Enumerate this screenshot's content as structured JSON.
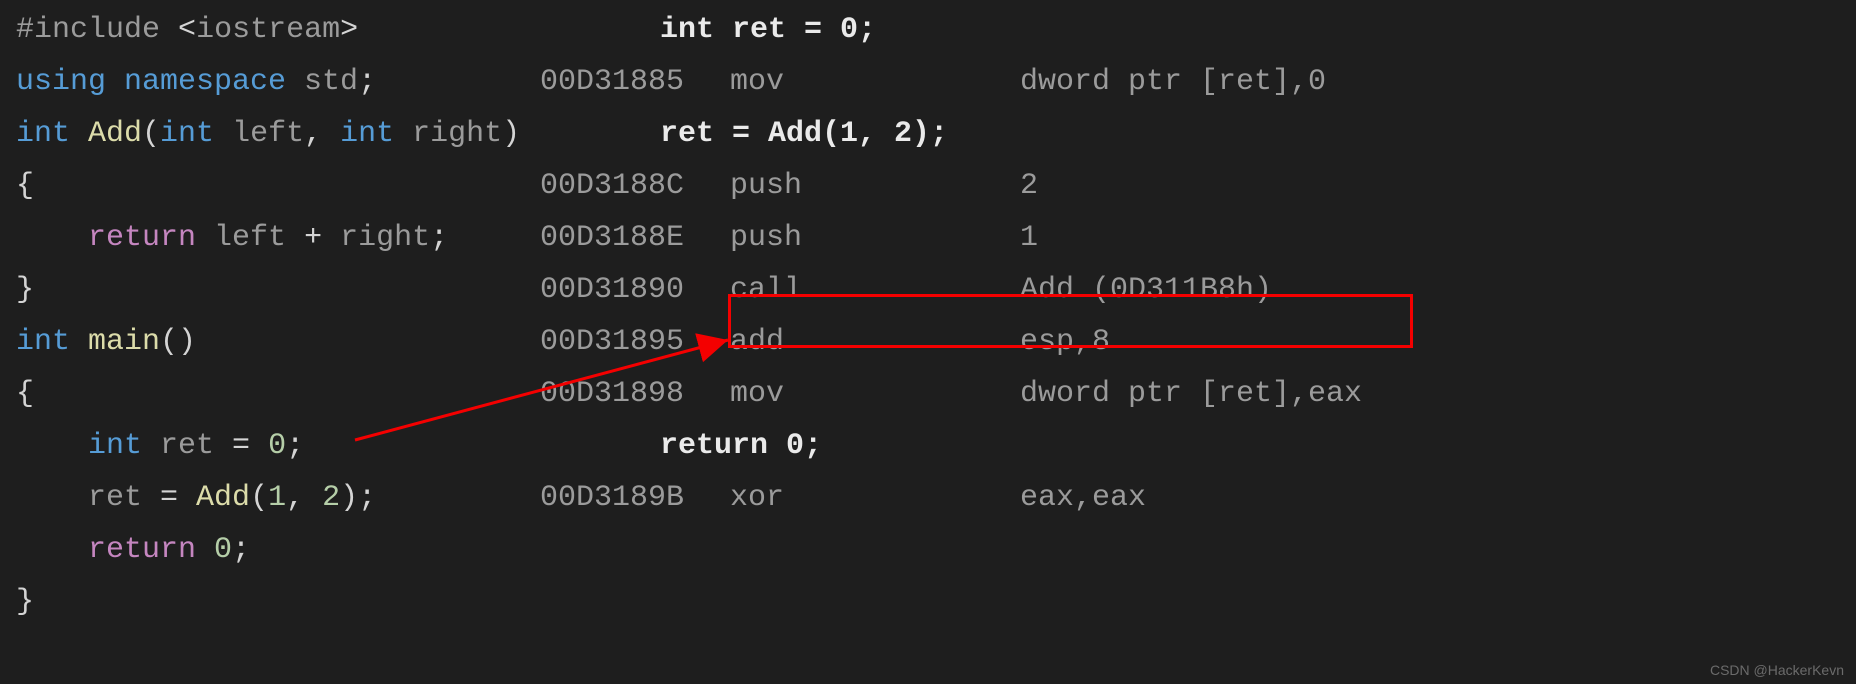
{
  "source": {
    "line0_before": "#",
    "line0_a": "include",
    "line0_b": " <",
    "line0_c": "iostream",
    "line0_d": ">",
    "line1_a": "using",
    "line1_b": " namespace",
    "line1_c": " std",
    "line1_d": ";",
    "line2_a": "int",
    "line2_b": " Add",
    "line2_c": "(",
    "line2_d": "int",
    "line2_e": " left",
    "line2_f": ", ",
    "line2_g": "int",
    "line2_h": " right",
    "line2_i": ")",
    "line3": "{",
    "line4_a": "    return",
    "line4_b": " left ",
    "line4_c": "+",
    "line4_d": " right",
    "line4_e": ";",
    "line5": "}",
    "line6_a": "int",
    "line6_b": " main",
    "line6_c": "()",
    "line7": "{",
    "line8_a": "    int",
    "line8_b": " ret ",
    "line8_c": "=",
    "line8_d": " 0",
    "line8_e": ";",
    "line9_a": "    ret ",
    "line9_b": "=",
    "line9_c": " Add",
    "line9_d": "(",
    "line9_e": "1",
    "line9_f": ", ",
    "line9_g": "2",
    "line9_h": ");",
    "line10_a": "    return",
    "line10_b": " 0",
    "line10_c": ";",
    "line11": "}"
  },
  "disasm": {
    "s0": "int ret = 0;",
    "r0_addr": "00D31885",
    "r0_mn": "mov",
    "r0_op": "dword ptr [ret],0",
    "s1": "ret = Add(1, 2);",
    "r1_addr": "00D3188C",
    "r1_mn": "push",
    "r1_op": "2",
    "r2_addr": "00D3188E",
    "r2_mn": "push",
    "r2_op": "1",
    "r3_addr": "00D31890",
    "r3_mn": "call",
    "r3_op": "Add (0D311B8h)",
    "r4_addr": "00D31895",
    "r4_mn": "add",
    "r4_op": "esp,8",
    "r5_addr": "00D31898",
    "r5_mn": "mov",
    "r5_op": "dword ptr [ret],eax",
    "s2": "return 0;",
    "r6_addr": "00D3189B",
    "r6_mn": "xor",
    "r6_op": "eax,eax"
  },
  "watermark": "CSDN @HackerKevn"
}
